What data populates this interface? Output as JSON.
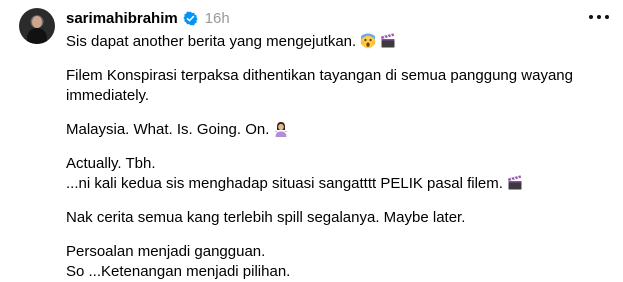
{
  "post": {
    "username": "sarimahibrahim",
    "timestamp": "16h",
    "lines": [
      "Sis dapat another berita yang mengejutkan.",
      "Filem Konspirasi terpaksa dithentikan tayangan di semua panggung wayang",
      "immediately.",
      "Malaysia. What. Is. Going. On.",
      "Actually. Tbh.",
      "...ni kali kedua sis menghadap situasi sangatttt PELIK pasal filem.",
      "Nak cerita semua kang terlebih spill segalanya. Maybe later.",
      "Persoalan menjadi gangguan.",
      "So ...Ketenangan menjadi pilihan."
    ]
  },
  "icons": {
    "verified": "verified-badge-icon",
    "more": "more-options-icon",
    "avatar": "profile-avatar",
    "emoji_1": "screaming-face-emoji",
    "emoji_2": "clapper-board-emoji",
    "emoji_3": "woman-shrugging-emoji",
    "emoji_4": "clapper-board-emoji"
  },
  "colors": {
    "verified_blue": "#0095f6",
    "timestamp_gray": "#999999"
  }
}
